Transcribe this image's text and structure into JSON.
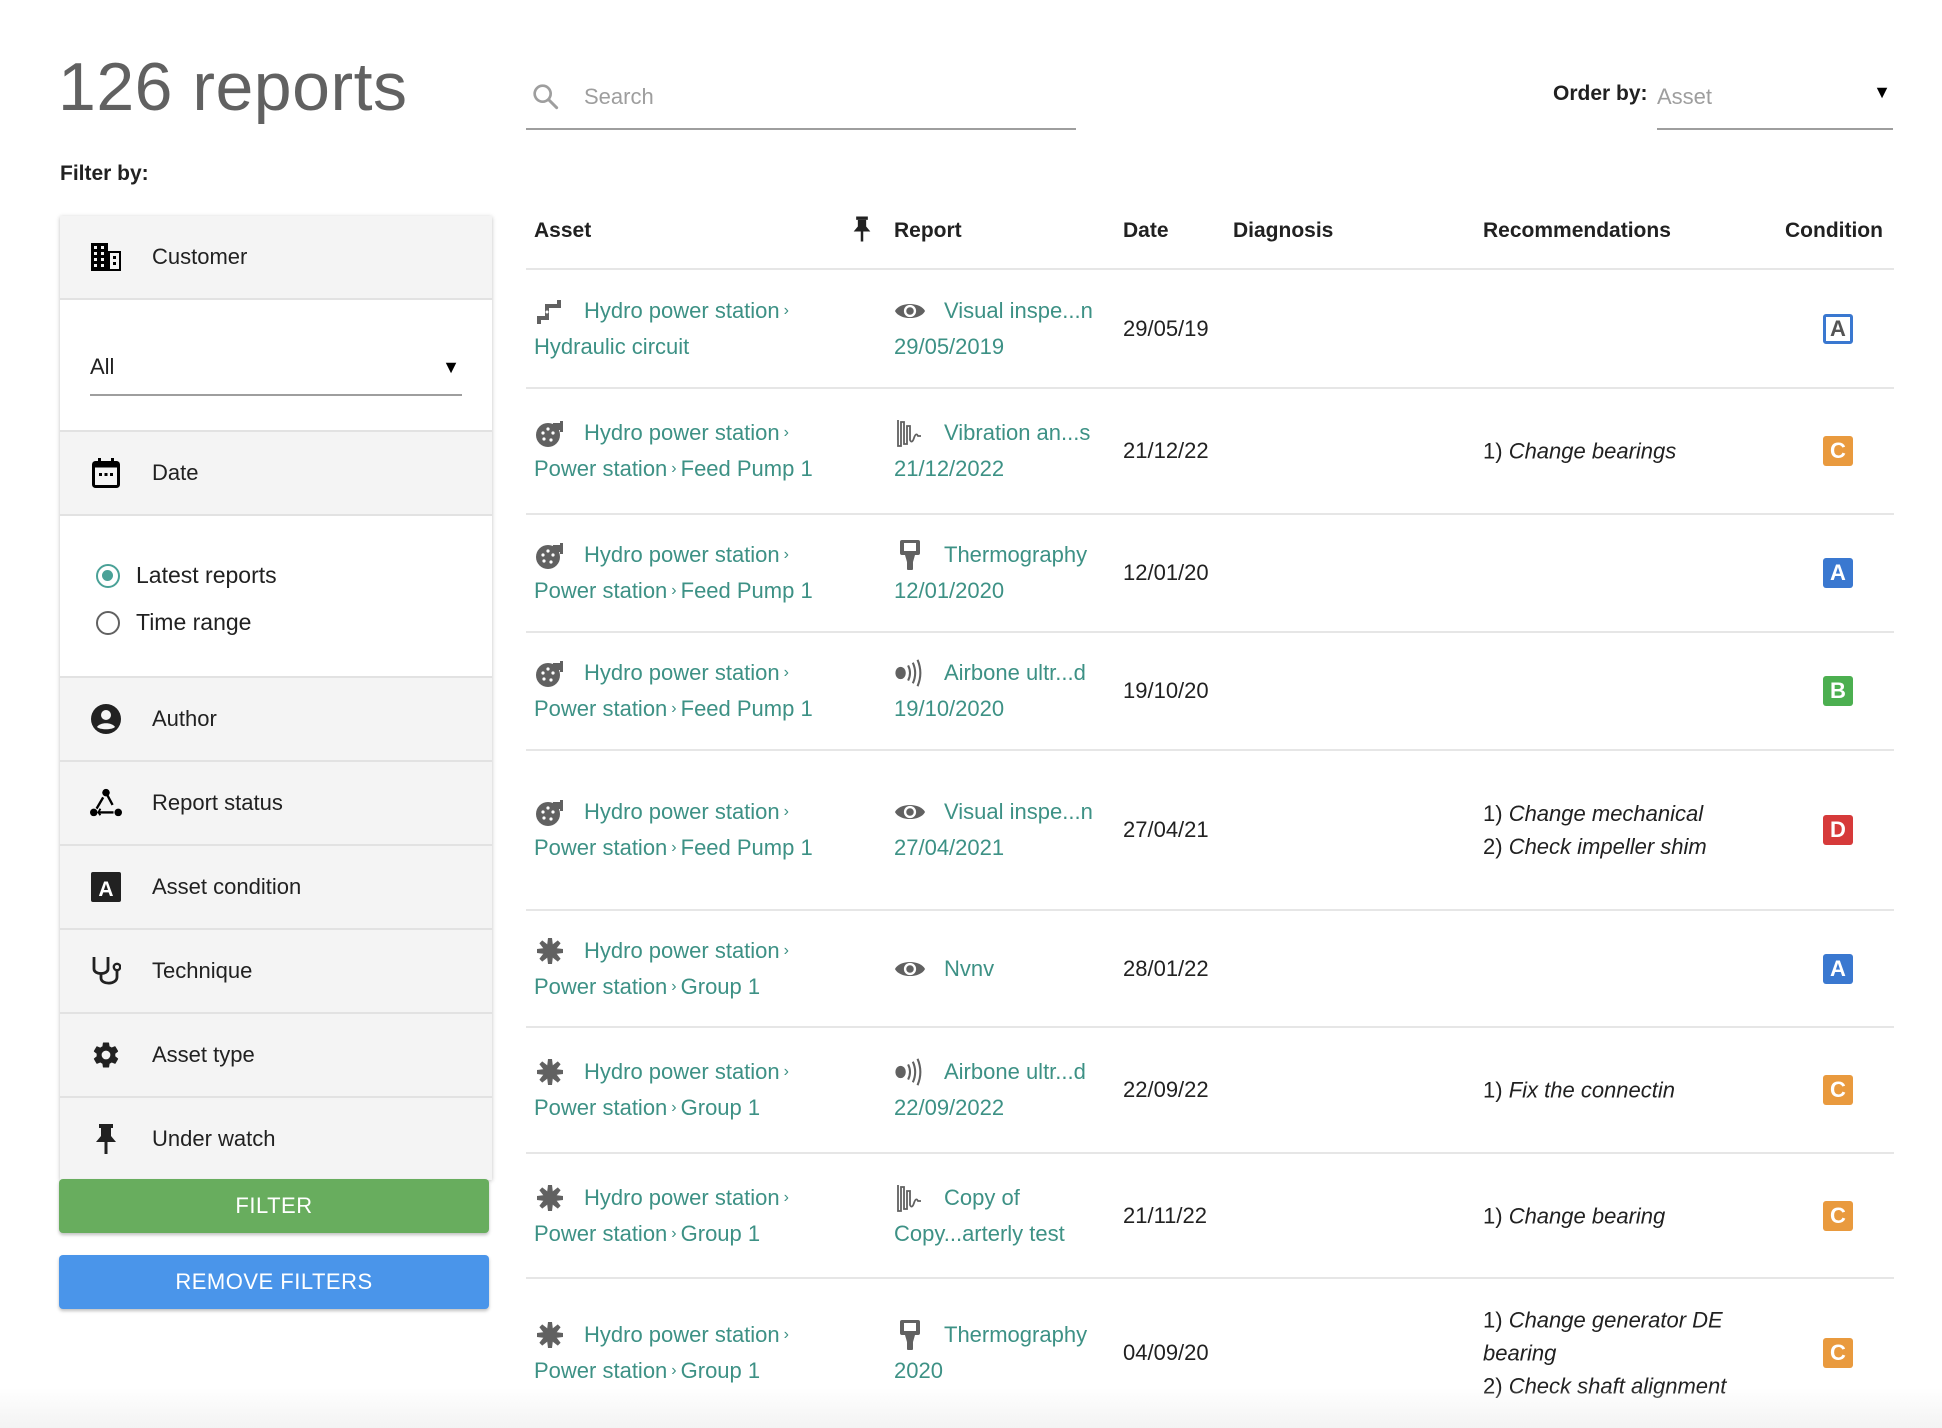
{
  "header": {
    "title": "126 reports",
    "filter_by_label": "Filter by:",
    "search_placeholder": "Search",
    "search_value": "",
    "order_by_label": "Order by:",
    "order_by_value": "Asset"
  },
  "filters": {
    "customer": {
      "label": "Customer",
      "icon": "building-icon",
      "select_value": "All"
    },
    "date": {
      "label": "Date",
      "icon": "calendar-icon",
      "options": [
        {
          "label": "Latest reports",
          "checked": true
        },
        {
          "label": "Time range",
          "checked": false
        }
      ]
    },
    "items": [
      {
        "label": "Author",
        "icon": "account-circle-icon"
      },
      {
        "label": "Report status",
        "icon": "workflow-icon"
      },
      {
        "label": "Asset condition",
        "icon": "condition-a-icon"
      },
      {
        "label": "Technique",
        "icon": "stethoscope-icon"
      },
      {
        "label": "Asset type",
        "icon": "gear-icon"
      },
      {
        "label": "Under watch",
        "icon": "pin-icon"
      }
    ],
    "filter_button": "FILTER",
    "remove_button": "REMOVE FILTERS"
  },
  "colors": {
    "link": "#3d9185",
    "filter_button": "#68ad5e",
    "remove_button": "#4a95ea",
    "condition": {
      "A": "#3a78d0",
      "B": "#4caf50",
      "C": "#e99a3e",
      "D": "#d63a3a"
    }
  },
  "table": {
    "columns": [
      "Asset",
      "Report",
      "Date",
      "Diagnosis",
      "Recommendations",
      "Condition"
    ],
    "rows": [
      {
        "asset_icon": "pipe-icon",
        "asset_line1": "Hydro power station",
        "asset_line2a": "Hydraulic circuit",
        "asset_line2b": "",
        "report_icon": "eye-icon",
        "report_title": "Visual inspe...n",
        "report_date": "29/05/2019",
        "date": "29/05/19",
        "diagnosis": "",
        "recommendations": [],
        "condition": "A",
        "condition_style": "outline"
      },
      {
        "asset_icon": "pump-icon",
        "asset_line1": "Hydro power station",
        "asset_line2a": "Power station",
        "asset_line2b": "Feed Pump 1",
        "report_icon": "vibration-icon",
        "report_title": "Vibration an...s",
        "report_date": "21/12/2022",
        "date": "21/12/22",
        "diagnosis": "",
        "recommendations": [
          "Change bearings"
        ],
        "condition": "C",
        "condition_style": "filled"
      },
      {
        "asset_icon": "pump-icon",
        "asset_line1": "Hydro power station",
        "asset_line2a": "Power station",
        "asset_line2b": "Feed Pump 1",
        "report_icon": "thermography-icon",
        "report_title": "Thermography",
        "report_date": "12/01/2020",
        "date": "12/01/20",
        "diagnosis": "",
        "recommendations": [],
        "condition": "A",
        "condition_style": "filled"
      },
      {
        "asset_icon": "pump-icon",
        "asset_line1": "Hydro power station",
        "asset_line2a": "Power station",
        "asset_line2b": "Feed Pump 1",
        "report_icon": "ultrasound-icon",
        "report_title": "Airbone ultr...d",
        "report_date": "19/10/2020",
        "date": "19/10/20",
        "diagnosis": "",
        "recommendations": [],
        "condition": "B",
        "condition_style": "filled"
      },
      {
        "asset_icon": "pump-icon",
        "asset_line1": "Hydro power station",
        "asset_line2a": "Power station",
        "asset_line2b": "Feed Pump 1",
        "report_icon": "eye-icon",
        "report_title": "Visual inspe...n",
        "report_date": "27/04/2021",
        "date": "27/04/21",
        "diagnosis": "",
        "recommendations": [
          "Change mechanical",
          "Check impeller shim"
        ],
        "condition": "D",
        "condition_style": "filled"
      },
      {
        "asset_icon": "turbine-icon",
        "asset_line1": "Hydro power station",
        "asset_line2a": "Power station",
        "asset_line2b": "Group 1",
        "report_icon": "eye-icon",
        "report_title": "Nvnv",
        "report_date": "",
        "date": "28/01/22",
        "diagnosis": "",
        "recommendations": [],
        "condition": "A",
        "condition_style": "filled"
      },
      {
        "asset_icon": "turbine-icon",
        "asset_line1": "Hydro power station",
        "asset_line2a": "Power station",
        "asset_line2b": "Group 1",
        "report_icon": "ultrasound-icon",
        "report_title": "Airbone ultr...d",
        "report_date": "22/09/2022",
        "date": "22/09/22",
        "diagnosis": "",
        "recommendations": [
          "Fix the connectin"
        ],
        "condition": "C",
        "condition_style": "filled"
      },
      {
        "asset_icon": "turbine-icon",
        "asset_line1": "Hydro power station",
        "asset_line2a": "Power station",
        "asset_line2b": "Group 1",
        "report_icon": "vibration-icon",
        "report_title": "Copy of",
        "report_date": "Copy...arterly test",
        "date": "21/11/22",
        "diagnosis": "",
        "recommendations": [
          "Change bearing"
        ],
        "condition": "C",
        "condition_style": "filled"
      },
      {
        "asset_icon": "turbine-icon",
        "asset_line1": "Hydro power station",
        "asset_line2a": "Power station",
        "asset_line2b": "Group 1",
        "report_icon": "thermography-icon",
        "report_title": "Thermography",
        "report_date": "2020",
        "date": "04/09/20",
        "diagnosis": "",
        "recommendations": [
          "Change generator DE bearing",
          "Check shaft alignment"
        ],
        "condition": "C",
        "condition_style": "filled"
      }
    ]
  }
}
